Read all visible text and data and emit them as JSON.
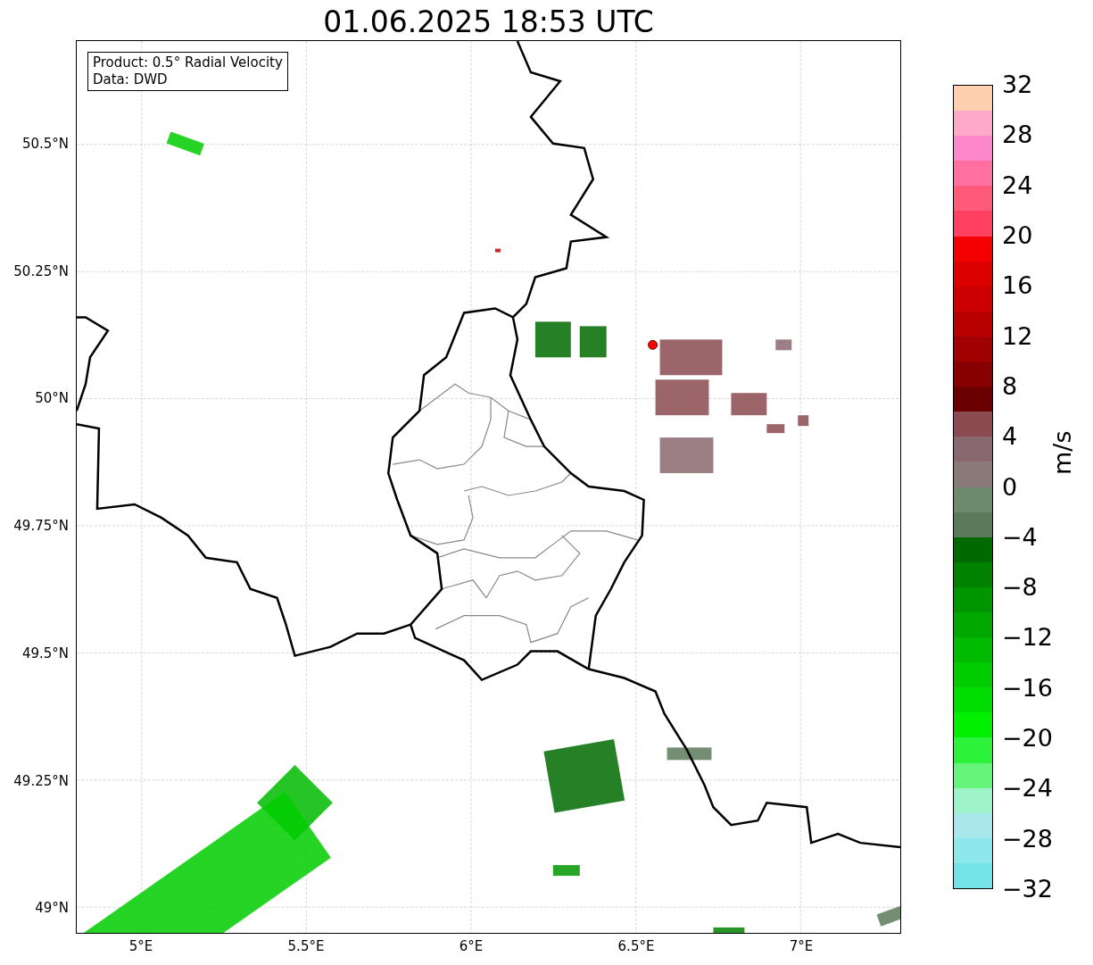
{
  "title": "01.06.2025 18:53 UTC",
  "legend": [
    "Product: 0.5° Radial Velocity",
    "Data: DWD"
  ],
  "y_ticks": [
    "50.5°N",
    "50.25°N",
    "50°N",
    "49.75°N",
    "49.5°N",
    "49.25°N",
    "49°N"
  ],
  "x_ticks": [
    "5°E",
    "5.5°E",
    "6°E",
    "6.5°E",
    "7°E"
  ],
  "colorbar": {
    "label": "m/s",
    "ticks": [
      "32",
      "28",
      "24",
      "20",
      "16",
      "12",
      "8",
      "4",
      "0",
      "−4",
      "−8",
      "−12",
      "−16",
      "−20",
      "−24",
      "−28",
      "−32"
    ],
    "bands": [
      {
        "color": "#ffd0b0"
      },
      {
        "color": "#ffa8c8"
      },
      {
        "color": "#ff88cc"
      },
      {
        "color": "#ff70a0"
      },
      {
        "color": "#ff5a7a"
      },
      {
        "color": "#ff4060"
      },
      {
        "color": "#f40000"
      },
      {
        "color": "#dd0000"
      },
      {
        "color": "#cc0000"
      },
      {
        "color": "#b80000"
      },
      {
        "color": "#a00000"
      },
      {
        "color": "#880000"
      },
      {
        "color": "#6a0000"
      },
      {
        "color": "#8a4a50"
      },
      {
        "color": "#8a6870"
      },
      {
        "color": "#8a7a7a"
      },
      {
        "color": "#6e8a6e"
      },
      {
        "color": "#5a7a5a"
      },
      {
        "color": "#006a00"
      },
      {
        "color": "#008200"
      },
      {
        "color": "#009600"
      },
      {
        "color": "#00a800"
      },
      {
        "color": "#00bb00"
      },
      {
        "color": "#00cc00"
      },
      {
        "color": "#00dd00"
      },
      {
        "color": "#00f000"
      },
      {
        "color": "#2cf33a"
      },
      {
        "color": "#66f47a"
      },
      {
        "color": "#9ef2c8"
      },
      {
        "color": "#a8e8ec"
      },
      {
        "color": "#8ce8ea"
      },
      {
        "color": "#74e3e8"
      }
    ]
  }
}
